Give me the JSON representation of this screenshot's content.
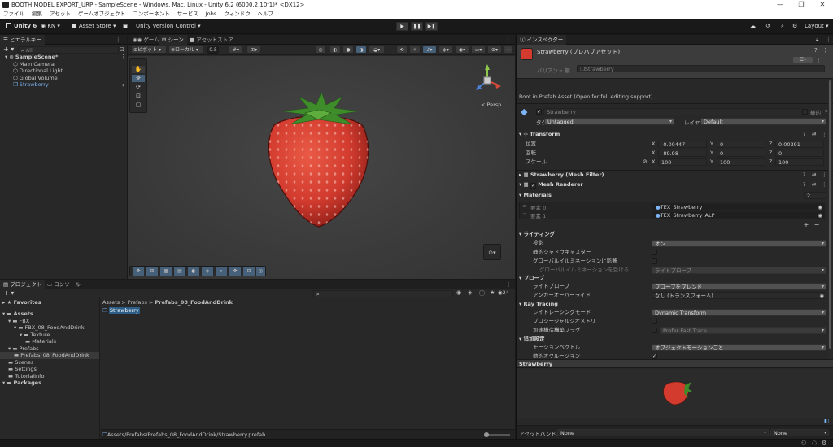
{
  "window": {
    "title": "BOOTH MODEL EXPORT_URP - SampleScene - Windows, Mac, Linux - Unity 6.2 (6000.2.10f1)* <DX12>",
    "minimize": "—",
    "maximize": "❐",
    "close": "✕"
  },
  "menu": [
    "ファイル",
    "編集",
    "アセット",
    "ゲームオブジェクト",
    "コンポーネント",
    "サービス",
    "Jobs",
    "ウィンドウ",
    "ヘルプ"
  ],
  "toolbar": {
    "unity_label": "Unity 6",
    "account": "KN",
    "asset_store": "Asset Store",
    "version_control": "Unity Version Control",
    "layout": "Layout",
    "play_icon": "▶",
    "pause_icon": "❚❚",
    "step_icon": "▶❚"
  },
  "hierarchy": {
    "tab": "ヒエラルキー",
    "search_placeholder": "All",
    "items": [
      {
        "label": "SampleScene*",
        "level": 0,
        "bold": true
      },
      {
        "label": "Main Camera",
        "level": 1
      },
      {
        "label": "Directional Light",
        "level": 1
      },
      {
        "label": "Global Volume",
        "level": 1
      },
      {
        "label": "Strawberry",
        "level": 1,
        "prefab": true
      }
    ]
  },
  "scene_tabs": {
    "game": "ゲーム",
    "scene": "シーン",
    "asset_store": "アセットストア"
  },
  "scene_toolbar": {
    "pivot": "ピボット",
    "local": "ローカル",
    "snap_value": "0.5",
    "persp": "< Persp"
  },
  "project": {
    "tab_project": "プロジェクト",
    "tab_console": "コンソール",
    "favorites": "Favorites",
    "tree": [
      {
        "label": "Assets",
        "level": 0
      },
      {
        "label": "FBX",
        "level": 1
      },
      {
        "label": "FBX_08_FoodAndDrink",
        "level": 2
      },
      {
        "label": "Texture",
        "level": 3
      },
      {
        "label": "Materials",
        "level": 4
      },
      {
        "label": "Prefabs",
        "level": 1
      },
      {
        "label": "Prefabs_08_FoodAndDrink",
        "level": 2,
        "selected": true
      },
      {
        "label": "Scenes",
        "level": 1
      },
      {
        "label": "Settings",
        "level": 1
      },
      {
        "label": "TutorialInfo",
        "level": 1
      },
      {
        "label": "Packages",
        "level": 0
      }
    ],
    "breadcrumb": [
      "Assets",
      "Prefabs",
      "Prefabs_08_FoodAndDrink"
    ],
    "breadcrumb_sep": ">",
    "selected_asset": "Strawberry",
    "footer_path": "Assets/Prefabs/Prefabs_08_FoodAndDrink/Strawberry.prefab",
    "count": "24"
  },
  "inspector": {
    "tab": "インスペクター",
    "header_title": "Strawberry (プレハブアセット)",
    "variant_label": "バリアント 親",
    "variant_value": "Strawberry",
    "root_note": "Root in Prefab Asset (Open for full editing support)",
    "object_name": "Strawberry",
    "static_label": "静的",
    "tag_label": "タグ",
    "tag_value": "Untagged",
    "layer_label": "レイヤー",
    "layer_value": "Default",
    "transform": {
      "title": "Transform",
      "position_label": "位置",
      "rotation_label": "回転",
      "scale_label": "スケール",
      "position": {
        "x": "-0.00447",
        "y": "0",
        "z": "0.00391"
      },
      "rotation": {
        "x": "-89.98",
        "y": "0",
        "z": "0"
      },
      "scale": {
        "x": "100",
        "y": "100",
        "z": "100"
      }
    },
    "axis": {
      "x": "X",
      "y": "Y",
      "z": "Z"
    },
    "mesh_filter": "Strawberry (Mesh Filter)",
    "mesh_renderer": "Mesh Renderer",
    "materials_label": "Materials",
    "materials_count": "2",
    "element0_label": "要素 0",
    "element0_value": "TEX_Strawberry",
    "element1_label": "要素 1",
    "element1_value": "TEX_Strawberry_ALP",
    "lighting": {
      "title": "ライティング",
      "cast_shadows_label": "投影",
      "cast_shadows_value": "オン",
      "static_shadow_caster": "静的シャドウキャスター",
      "contribute_gi": "グローバルイルミネーションに影響",
      "receive_gi_label": "グローバルイルミネーションを受ける",
      "receive_gi_value": "ライトプローブ"
    },
    "probes": {
      "title": "プローブ",
      "light_probe_label": "ライトプローブ",
      "light_probe_value": "プローブをブレンド",
      "anchor_label": "アンカーオーバーライド",
      "anchor_value": "なし (トランスフォーム)"
    },
    "raytracing": {
      "title": "Ray Tracing",
      "mode_label": "レイトレーシングモード",
      "mode_value": "Dynamic Transform",
      "procedural_label": "プロシージャルジオメトリ",
      "accel_label": "加速構造構築フラグ",
      "accel_value": "Prefer Fast Trace"
    },
    "additional": {
      "title": "追加設定",
      "motion_label": "モーションベクトル",
      "motion_value": "オブジェクトモーションごと",
      "occlusion_label": "動的オクルージョン"
    },
    "preview_title": "Strawberry",
    "asset_bundle_label": "アセットバンドル",
    "asset_bundle_value": "None",
    "asset_bundle_variant": "None"
  },
  "colors": {
    "accent": "#2c5d87",
    "selection": "#2c5d87",
    "prefab_blue": "#7cb4f5",
    "strawberry_red": "#d23b2e",
    "leaf_green": "#3f8c2a"
  }
}
